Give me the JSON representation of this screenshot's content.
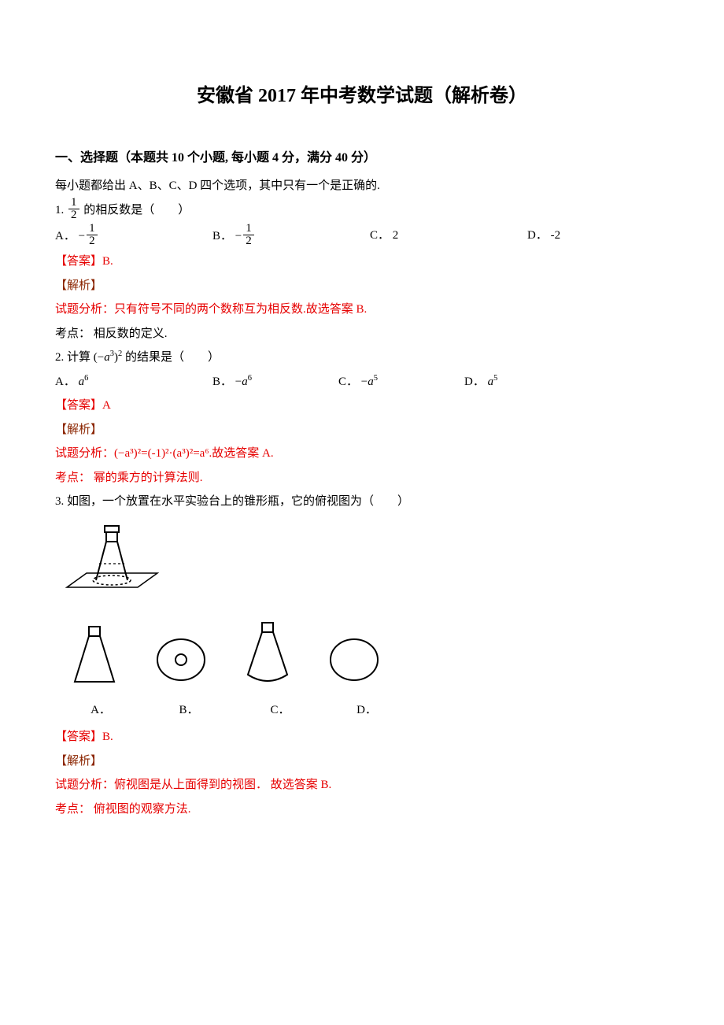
{
  "title": "安徽省 2017 年中考数学试题（解析卷）",
  "section1": {
    "header": "一、选择题（本题共 10 个小题, 每小题 4 分，满分 40 分）",
    "intro": "每小题都给出 A、B、C、D 四个选项，其中只有一个是正确的."
  },
  "labels": {
    "answer": "【答案】",
    "analysis": "【解析】",
    "kaodian": "考点：",
    "shiti": "试题分析："
  },
  "q1": {
    "prefix": "1.",
    "suffix": " 的相反数是（　　）",
    "frac_num": "1",
    "frac_den": "2",
    "optA_label": "A．",
    "optA_neg": "−",
    "optA_num": "1",
    "optA_den": "2",
    "optB_label": "B．",
    "optB_neg": "−",
    "optB_num": "1",
    "optB_den": "2",
    "optC_label": "C．",
    "optC_val": "2",
    "optD_label": "D．",
    "optD_val": "-2",
    "answer": "B.",
    "analysis": "只有符号不同的两个数称互为相反数.故选答案 B.",
    "kaodian": " 相反数的定义."
  },
  "q2": {
    "prefix": "2. 计算",
    "expr_l": "(−",
    "expr_a": "a",
    "expr_p1": "3",
    "expr_r": ")",
    "expr_p2": "2",
    "suffix": " 的结果是（　　）",
    "optA_label": "A．",
    "optA_a": "a",
    "optA_p": "6",
    "optB_label": "B．",
    "optB_neg": "−",
    "optB_a": "a",
    "optB_p": "6",
    "optC_label": "C．",
    "optC_neg": "−",
    "optC_a": "a",
    "optC_p": "5",
    "optD_label": "D．",
    "optD_a": "a",
    "optD_p": "5",
    "answer": "A",
    "analysis_pre": "试题分析：",
    "analysis_expr": "(−a³)²=(-1)²·(a³)²=a⁶",
    "analysis_post": ".故选答案 A.",
    "kaodian": " 幂的乘方的计算法则."
  },
  "q3": {
    "text": "3. 如图，一个放置在水平实验台上的锥形瓶，它的俯视图为（　　）",
    "optA": "A．",
    "optB": "B．",
    "optC": "C．",
    "optD": "D．",
    "answer": "B.",
    "analysis": "俯视图是从上面得到的视图． 故选答案 B.",
    "kaodian": " 俯视图的观察方法."
  }
}
